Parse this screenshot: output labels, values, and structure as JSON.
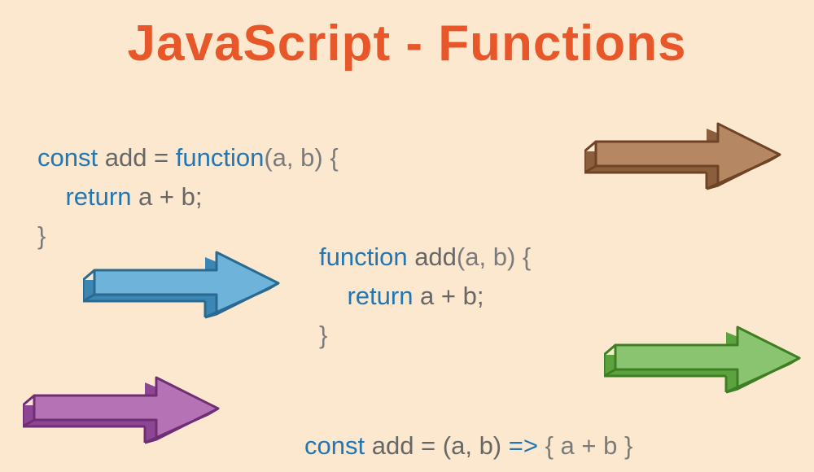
{
  "title": "JavaScript - Functions",
  "snippets": {
    "expression": {
      "l1": {
        "keyword": "const",
        "name": " add = ",
        "keyword2": "function",
        "params": "(a, b) {"
      },
      "l2": {
        "indent": "    ",
        "keyword": "return",
        "rest": " a + b;"
      },
      "l3": "}"
    },
    "declaration": {
      "l1": {
        "keyword": "function",
        "name": " add",
        "params": "(a, b) {"
      },
      "l2": {
        "indent": "    ",
        "keyword": "return",
        "rest": " a + b;"
      },
      "l3": "}"
    },
    "arrow": {
      "l1": {
        "keyword": "const",
        "name": " add = (a, b) ",
        "arrow": "=>",
        "body": " { a + b }"
      }
    }
  },
  "arrows": {
    "brown": {
      "light": "#b58863",
      "dark": "#8b5f3d",
      "stroke": "#6f4426"
    },
    "blue": {
      "light": "#6eb3d9",
      "dark": "#3a87b5",
      "stroke": "#2a6a91"
    },
    "green": {
      "light": "#8bc470",
      "dark": "#5ca23e",
      "stroke": "#3f7f24"
    },
    "purple": {
      "light": "#b573b5",
      "dark": "#8d4693",
      "stroke": "#6f2e75"
    }
  }
}
